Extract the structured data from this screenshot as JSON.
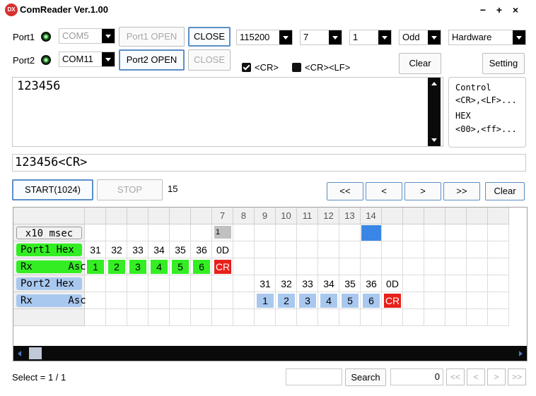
{
  "title": "ComReader Ver.1.00",
  "app_icon_text": "DX",
  "window_controls": {
    "minimize": "−",
    "maximize": "+",
    "close": "×"
  },
  "port1": {
    "label": "Port1",
    "port": "COM5",
    "open_label": "Port1 OPEN",
    "close_label": "CLOSE"
  },
  "port2": {
    "label": "Port2",
    "port": "COM11",
    "open_label": "Port2 OPEN",
    "close_label": "CLOSE"
  },
  "settings": {
    "baud": "115200",
    "databits": "7",
    "stopbits": "1",
    "parity": "Odd",
    "flow": "Hardware"
  },
  "terminators": {
    "cr_label": "<CR>",
    "crlf_label": "<CR><LF>",
    "cr_checked": true,
    "crlf_checked": false
  },
  "clear_label": "Clear",
  "setting_label": "Setting",
  "send_text": "123456",
  "hint": {
    "line1": "Control",
    "line2": "<CR>,<LF>...",
    "line3": "HEX",
    "line4": "<00>,<ff>..."
  },
  "received_line": "123456<CR>",
  "start_label": "START(1024)",
  "stop_label": "STOP",
  "count": "15",
  "nav": {
    "first": "<<",
    "prev": "<",
    "next": ">",
    "last": ">>",
    "clear": "Clear"
  },
  "grid": {
    "col_headers": [
      "",
      "",
      "",
      "",
      "",
      "",
      "7",
      "8",
      "9",
      "10",
      "11",
      "12",
      "13",
      "14",
      "",
      "",
      "",
      "",
      "",
      ""
    ],
    "row_labels": [
      "x10 msec",
      "Port1 Hex",
      "Rx      Asc",
      "Port2 Hex",
      "Rx      Asc"
    ],
    "msec_marker": "1",
    "port1_hex": [
      "31",
      "32",
      "33",
      "34",
      "35",
      "36",
      "0D"
    ],
    "port1_asc": [
      "1",
      "2",
      "3",
      "4",
      "5",
      "6",
      "CR"
    ],
    "port2_hex": [
      "31",
      "32",
      "33",
      "34",
      "35",
      "36",
      "0D"
    ],
    "port2_asc": [
      "1",
      "2",
      "3",
      "4",
      "5",
      "6",
      "CR"
    ]
  },
  "colors": {
    "green": "#33ee22",
    "blue": "#a9c8ef",
    "red": "#e8201b",
    "select": "#3a86e6",
    "marker": "#c0c0c0"
  },
  "footer": {
    "select_text": "Select = 1 / 1",
    "search_label": "Search",
    "page_value": "0",
    "first": "<<",
    "prev": "<",
    "next": ">",
    "last": ">>"
  }
}
